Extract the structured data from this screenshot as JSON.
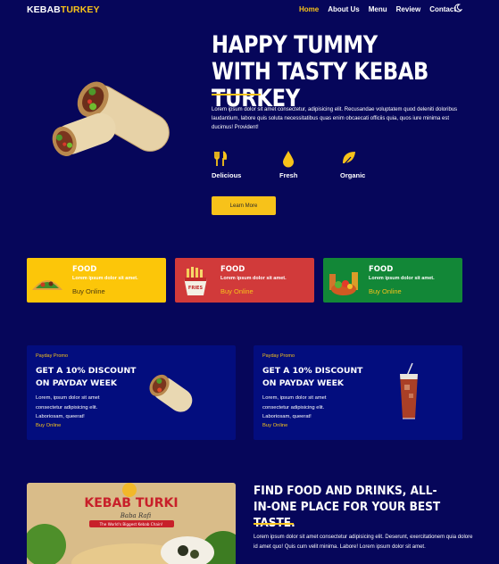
{
  "nav": {
    "logo_part1": "KEBAB",
    "logo_part2": "TURKEY",
    "items": [
      "Home",
      "About Us",
      "Menu",
      "Review",
      "Contact"
    ],
    "theme_icon": "moon-icon"
  },
  "hero": {
    "title": "HAPPY TUMMY WITH TASTY KEBAB TURKEY",
    "text": "Lorem ipsum dolor sit amet consectetur, adipisicing elit. Recusandae voluptatem quod deleniti doloribus laudantium, labore quis soluta necessitatibus quas enim obcaecati officiis quia, quos iure minima est ducimus! Provident!",
    "features": [
      {
        "label": "Delicious",
        "icon": "utensils-icon"
      },
      {
        "label": "Fresh",
        "icon": "droplet-icon"
      },
      {
        "label": "Organic",
        "icon": "leaf-icon"
      }
    ],
    "button": "Learn More"
  },
  "food_cards": [
    {
      "title": "FOOD",
      "subtitle": "Lorem ipsum dolor sit amet.",
      "link": "Buy Online",
      "color": "#fcc609"
    },
    {
      "title": "FOOD",
      "subtitle": "Lorem ipsum dolor sit amet.",
      "link": "Buy Online",
      "color": "#d13a3a"
    },
    {
      "title": "FOOD",
      "subtitle": "Lorem ipsum dolor sit amet.",
      "link": "Buy Online",
      "color": "#128737"
    }
  ],
  "promos": [
    {
      "tag": "Payday Promo",
      "heading": "GET A 10% DISCOUNT ON PAYDAY WEEK",
      "text": "Lorem, ipsum dolor sit amet consectetur adipisicing elit. Laboriosam, queerat!",
      "link": "Buy Online"
    },
    {
      "tag": "Payday Promo",
      "heading": "GET A 10% DISCOUNT ON PAYDAY WEEK",
      "text": "Lorem, ipsum dolor sit amet consectetur adipisicing elit. Laboriosam, queerat!",
      "link": "Buy Online"
    }
  ],
  "about": {
    "poster_brand": "KEBAB TURKI",
    "poster_sub": "Baba Rafi",
    "poster_tag": "The World's Biggest Kebab Chain!",
    "title": "FIND FOOD AND DRINKS, ALL-IN-ONE PLACE FOR YOUR BEST TASTE.",
    "text": "Lorem ipsum dolor sit amet consectetur adipisicing elit. Deserunt, exercitationem quia dolore id amet quo! Quis cum velit minima. Labore! Lorem ipsum dolor sit amet."
  },
  "colors": {
    "background": "#06065a",
    "accent": "#f7c21a",
    "card": "#030d7e"
  }
}
